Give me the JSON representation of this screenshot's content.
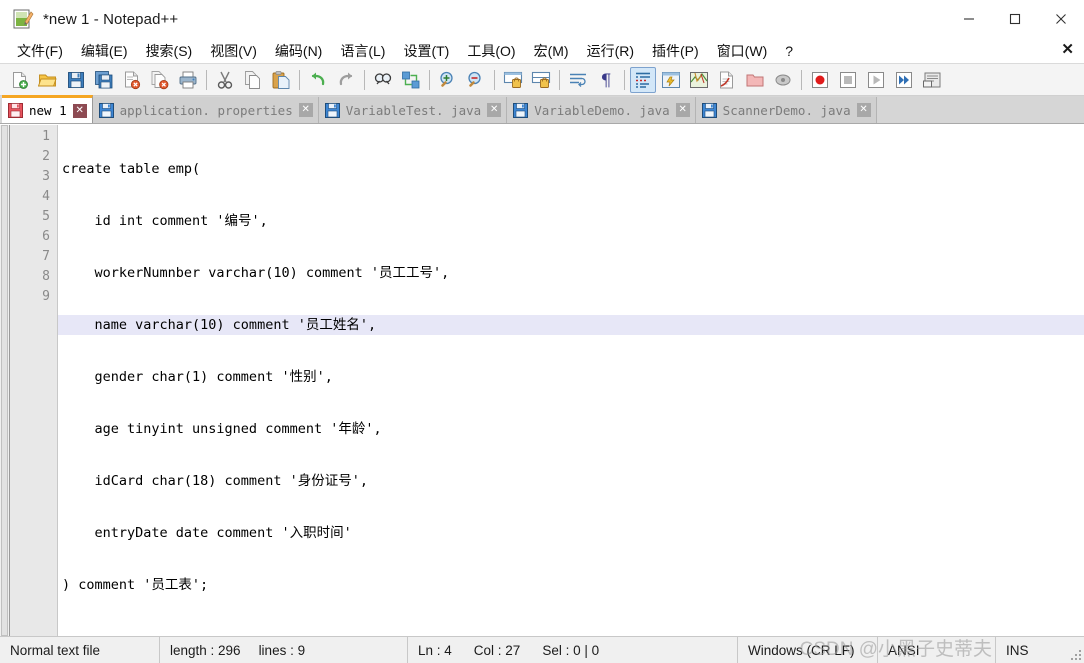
{
  "window": {
    "title": "*new 1 - Notepad++",
    "app_icon": "notepad-plus-plus-icon",
    "controls": {
      "minimize": "─",
      "maximize": "□",
      "close": "✕"
    }
  },
  "menubar": {
    "items": [
      {
        "label": "文件(F)",
        "name": "menu-file"
      },
      {
        "label": "编辑(E)",
        "name": "menu-edit"
      },
      {
        "label": "搜索(S)",
        "name": "menu-search"
      },
      {
        "label": "视图(V)",
        "name": "menu-view"
      },
      {
        "label": "编码(N)",
        "name": "menu-encoding"
      },
      {
        "label": "语言(L)",
        "name": "menu-language"
      },
      {
        "label": "设置(T)",
        "name": "menu-settings"
      },
      {
        "label": "工具(O)",
        "name": "menu-tools"
      },
      {
        "label": "宏(M)",
        "name": "menu-macro"
      },
      {
        "label": "运行(R)",
        "name": "menu-run"
      },
      {
        "label": "插件(P)",
        "name": "menu-plugins"
      },
      {
        "label": "窗口(W)",
        "name": "menu-window"
      },
      {
        "label": "?",
        "name": "menu-help"
      }
    ],
    "close_doc": "✕"
  },
  "toolbar": {
    "buttons": [
      {
        "name": "new-file-icon",
        "group": 0
      },
      {
        "name": "open-file-icon",
        "group": 0
      },
      {
        "name": "save-icon",
        "group": 0
      },
      {
        "name": "save-all-icon",
        "group": 0
      },
      {
        "name": "close-file-icon",
        "group": 0
      },
      {
        "name": "close-all-files-icon",
        "group": 0
      },
      {
        "name": "print-icon",
        "group": 0
      },
      {
        "name": "cut-icon",
        "group": 1
      },
      {
        "name": "copy-icon",
        "group": 1
      },
      {
        "name": "paste-icon",
        "group": 1
      },
      {
        "name": "undo-icon",
        "group": 2
      },
      {
        "name": "redo-icon",
        "group": 2
      },
      {
        "name": "find-icon",
        "group": 3
      },
      {
        "name": "replace-icon",
        "group": 3
      },
      {
        "name": "zoom-in-icon",
        "group": 4
      },
      {
        "name": "zoom-out-icon",
        "group": 4
      },
      {
        "name": "sync-vertical-scroll-icon",
        "group": 5
      },
      {
        "name": "sync-horizontal-scroll-icon",
        "group": 5
      },
      {
        "name": "word-wrap-icon",
        "group": 6
      },
      {
        "name": "show-all-characters-icon",
        "group": 6
      },
      {
        "name": "indent-guide-icon",
        "group": 7,
        "active": true
      },
      {
        "name": "user-defined-dialog-icon",
        "group": 7
      },
      {
        "name": "document-map-icon",
        "group": 7
      },
      {
        "name": "function-list-icon",
        "group": 7
      },
      {
        "name": "folder-as-workspace-icon",
        "group": 7
      },
      {
        "name": "monitoring-icon",
        "group": 7
      },
      {
        "name": "record-macro-icon",
        "group": 8
      },
      {
        "name": "stop-recording-icon",
        "group": 8
      },
      {
        "name": "play-macro-icon",
        "group": 8
      },
      {
        "name": "run-macro-multiple-icon",
        "group": 8
      },
      {
        "name": "run-icon",
        "group": 8
      }
    ]
  },
  "tabs": [
    {
      "label": "new 1",
      "active": true,
      "modified": true,
      "close": "✕",
      "icon": "unsaved-file-icon"
    },
    {
      "label": "application. properties",
      "active": false,
      "modified": false,
      "close": "✕",
      "icon": "saved-file-icon"
    },
    {
      "label": "VariableTest. java",
      "active": false,
      "modified": false,
      "close": "✕",
      "icon": "saved-file-icon"
    },
    {
      "label": "VariableDemo. java",
      "active": false,
      "modified": false,
      "close": "✕",
      "icon": "saved-file-icon"
    },
    {
      "label": "ScannerDemo. java",
      "active": false,
      "modified": false,
      "close": "✕",
      "icon": "saved-file-icon"
    }
  ],
  "editor": {
    "current_line": 4,
    "lines": [
      {
        "number": "1",
        "text": "create table emp("
      },
      {
        "number": "2",
        "text": "    id int comment '编号',"
      },
      {
        "number": "3",
        "text": "    workerNumnber varchar(10) comment '员工工号',"
      },
      {
        "number": "4",
        "text": "    name varchar(10) comment '员工姓名',"
      },
      {
        "number": "5",
        "text": "    gender char(1) comment '性别',"
      },
      {
        "number": "6",
        "text": "    age tinyint unsigned comment '年龄',"
      },
      {
        "number": "7",
        "text": "    idCard char(18) comment '身份证号',"
      },
      {
        "number": "8",
        "text": "    entryDate date comment '入职时间'"
      },
      {
        "number": "9",
        "text": ") comment '员工表';"
      }
    ]
  },
  "statusbar": {
    "doc_type": "Normal text file",
    "length_label": "length : 296",
    "lines_label": "lines : 9",
    "ln": "Ln : 4",
    "col": "Col : 27",
    "sel": "Sel : 0 | 0",
    "eol": "Windows (CR LF)",
    "encoding": "ANSI",
    "insert_mode": "INS"
  },
  "watermark": "CSDN @小黑子史蒂夫",
  "colors": {
    "active_tab_accent": "#f5a623",
    "tabbar_bg": "#d6d6d6",
    "gutter_bg": "#e8e8e8",
    "current_line_bg": "#e7e7f7",
    "toolbar_bg": "#f4f4f4",
    "statusbar_bg": "#f0f0f0"
  }
}
